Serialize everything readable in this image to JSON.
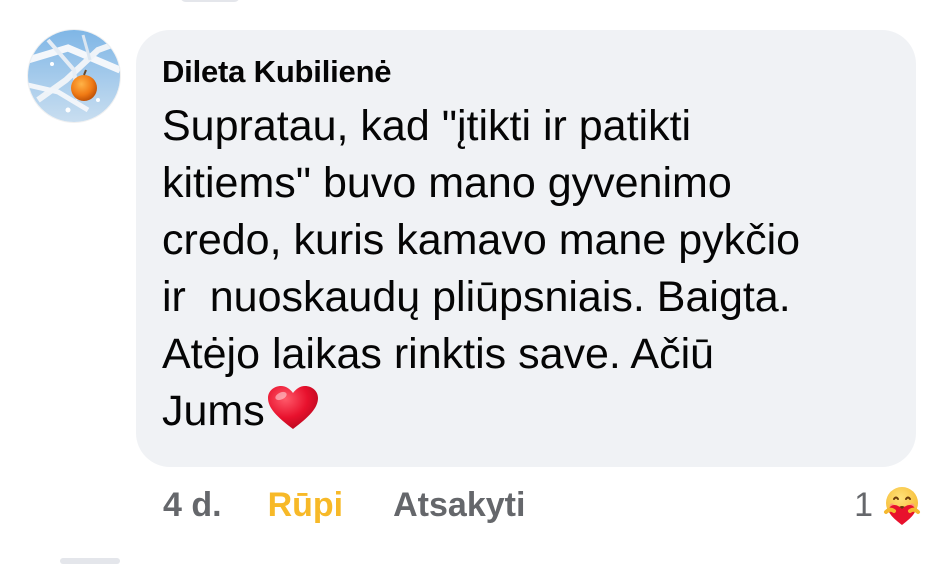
{
  "comment": {
    "author": "Dileta Kubilienė",
    "text": "Supratau, kad \"įtikti ir patikti\nkitiems\" buvo mano gyvenimo\ncredo, kuris kamavo mane pykčio\nir  nuoskaudų pliūpsniais. Baigta.\nAtėjo laikas rinktis save. Ačiū\nJums",
    "trailing_emoji": "red-heart-emoji",
    "avatar": "profile-photo-frosty-branch-orange"
  },
  "actions": {
    "time": "4 d.",
    "like_label": "Rūpi",
    "reply_label": "Atsakyti"
  },
  "reactions": {
    "count": "1",
    "icon": "care-reaction-icon"
  },
  "colors": {
    "bubble_bg": "#f0f2f5",
    "text": "#050505",
    "secondary": "#65676b",
    "care_active": "#f7b928",
    "heart": "#e8112d"
  }
}
